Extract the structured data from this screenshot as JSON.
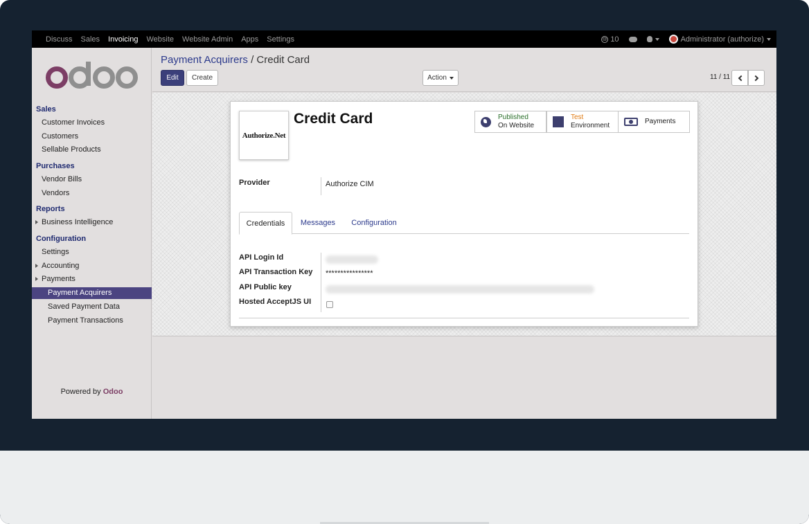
{
  "topbar": {
    "apps": [
      "Discuss",
      "Sales",
      "Invoicing",
      "Website",
      "Website Admin",
      "Apps",
      "Settings"
    ],
    "active_app": "Invoicing",
    "message_count": "10",
    "user": "Administrator (authorize)"
  },
  "logo_text": "odoo",
  "sidebar": {
    "sales_title": "Sales",
    "sales_items": [
      "Customer Invoices",
      "Customers",
      "Sellable Products"
    ],
    "purchases_title": "Purchases",
    "purchases_items": [
      "Vendor Bills",
      "Vendors"
    ],
    "reports_title": "Reports",
    "reports_items": [
      "Business Intelligence"
    ],
    "configuration_title": "Configuration",
    "configuration_items": [
      "Settings",
      "Accounting",
      "Payments"
    ],
    "payments_subitems": [
      "Payment Acquirers",
      "Saved Payment Data",
      "Payment Transactions"
    ],
    "active_item": "Payment Acquirers",
    "powered_by": "Powered by",
    "powered_brand": "Odoo"
  },
  "control": {
    "breadcrumb_parent": "Payment Acquirers",
    "breadcrumb_sep": "/",
    "breadcrumb_current": "Credit Card",
    "edit_label": "Edit",
    "create_label": "Create",
    "action_label": "Action",
    "pager": "11 / 11"
  },
  "record": {
    "image_text": "Authorize.Net",
    "title": "Credit Card",
    "published_top": "Published",
    "published_bottom": "On Website",
    "test_top": "Test",
    "test_bottom": "Environment",
    "payments_label": "Payments",
    "provider_label": "Provider",
    "provider_value": "Authorize CIM",
    "tabs": [
      "Credentials",
      "Messages",
      "Configuration"
    ],
    "active_tab": "Credentials",
    "api_login_label": "API Login Id",
    "api_txn_label": "API Transaction Key",
    "api_txn_value": "****************",
    "api_public_label": "API Public key",
    "hosted_label": "Hosted AcceptJS UI"
  },
  "colors": {
    "active_menu": "#4b4481",
    "primary_button": "#3b3f7a",
    "link": "#2c3a8c",
    "test_env": "#e07b13"
  }
}
